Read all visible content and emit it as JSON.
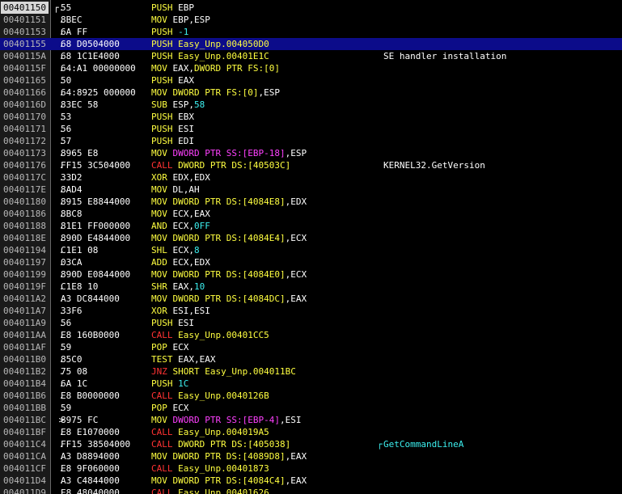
{
  "colors": {
    "background": "#000000",
    "address_column": "#1a1a1a",
    "selection": "#0c0c8a",
    "mnemonic": "#ffff40",
    "call_jump": "#ff3232",
    "pointer": "#ff40ff",
    "immediate": "#3cf0f0",
    "text": "#ffffff"
  },
  "rows": [
    {
      "addr": "00401150",
      "mark": "┌.",
      "hex": "55",
      "parts": [
        [
          "mnem",
          "PUSH "
        ],
        [
          "reg",
          "EBP"
        ]
      ],
      "comment": ""
    },
    {
      "addr": "00401151",
      "mark": " .",
      "hex": "8BEC",
      "parts": [
        [
          "mnem",
          "MOV "
        ],
        [
          "reg",
          "EBP,ESP"
        ]
      ],
      "comment": ""
    },
    {
      "addr": "00401153",
      "mark": " .",
      "hex": "6A FF",
      "parts": [
        [
          "mnem",
          "PUSH "
        ],
        [
          "imm",
          "-1"
        ]
      ],
      "comment": ""
    },
    {
      "addr": "00401155",
      "mark": " .",
      "hex": "68 D0504000",
      "parts": [
        [
          "mnem",
          "PUSH "
        ],
        [
          "sym",
          "Easy_Unp.004050D0"
        ]
      ],
      "comment": "",
      "selected": true
    },
    {
      "addr": "0040115A",
      "mark": " .",
      "hex": "68 1C1E4000",
      "parts": [
        [
          "mnem",
          "PUSH "
        ],
        [
          "sym",
          "Easy_Unp.00401E1C"
        ]
      ],
      "comment": "SE handler installation"
    },
    {
      "addr": "0040115F",
      "mark": " .",
      "hex": "64:A1 00000000",
      "parts": [
        [
          "mnem",
          "MOV "
        ],
        [
          "reg",
          "EAX,"
        ],
        [
          "mem",
          "DWORD PTR FS:[0]"
        ]
      ],
      "comment": ""
    },
    {
      "addr": "00401165",
      "mark": " .",
      "hex": "50",
      "parts": [
        [
          "mnem",
          "PUSH "
        ],
        [
          "reg",
          "EAX"
        ]
      ],
      "comment": ""
    },
    {
      "addr": "00401166",
      "mark": " .",
      "hex": "64:8925 000000",
      "parts": [
        [
          "mnem",
          "MOV "
        ],
        [
          "mem",
          "DWORD PTR FS:[0]"
        ],
        [
          "reg",
          ",ESP"
        ]
      ],
      "comment": ""
    },
    {
      "addr": "0040116D",
      "mark": " .",
      "hex": "83EC 58",
      "parts": [
        [
          "mnem",
          "SUB "
        ],
        [
          "reg",
          "ESP,"
        ],
        [
          "imm",
          "58"
        ]
      ],
      "comment": ""
    },
    {
      "addr": "00401170",
      "mark": " .",
      "hex": "53",
      "parts": [
        [
          "mnem",
          "PUSH "
        ],
        [
          "reg",
          "EBX"
        ]
      ],
      "comment": ""
    },
    {
      "addr": "00401171",
      "mark": " .",
      "hex": "56",
      "parts": [
        [
          "mnem",
          "PUSH "
        ],
        [
          "reg",
          "ESI"
        ]
      ],
      "comment": ""
    },
    {
      "addr": "00401172",
      "mark": " .",
      "hex": "57",
      "parts": [
        [
          "mnem",
          "PUSH "
        ],
        [
          "reg",
          "EDI"
        ]
      ],
      "comment": ""
    },
    {
      "addr": "00401173",
      "mark": " .",
      "hex": "8965 E8",
      "parts": [
        [
          "mnem",
          "MOV "
        ],
        [
          "ptr",
          "DWORD PTR SS:[EBP-18]"
        ],
        [
          "reg",
          ",ESP"
        ]
      ],
      "comment": ""
    },
    {
      "addr": "00401176",
      "mark": " .",
      "hex": "FF15 3C504000",
      "parts": [
        [
          "call",
          "CALL "
        ],
        [
          "mem",
          "DWORD PTR DS:[40503C]"
        ]
      ],
      "comment": "KERNEL32.GetVersion"
    },
    {
      "addr": "0040117C",
      "mark": " .",
      "hex": "33D2",
      "parts": [
        [
          "mnem",
          "XOR "
        ],
        [
          "reg",
          "EDX,EDX"
        ]
      ],
      "comment": ""
    },
    {
      "addr": "0040117E",
      "mark": " .",
      "hex": "8AD4",
      "parts": [
        [
          "mnem",
          "MOV "
        ],
        [
          "reg",
          "DL,AH"
        ]
      ],
      "comment": ""
    },
    {
      "addr": "00401180",
      "mark": " .",
      "hex": "8915 E8844000",
      "parts": [
        [
          "mnem",
          "MOV "
        ],
        [
          "mem",
          "DWORD PTR DS:[4084E8]"
        ],
        [
          "reg",
          ",EDX"
        ]
      ],
      "comment": ""
    },
    {
      "addr": "00401186",
      "mark": " .",
      "hex": "8BC8",
      "parts": [
        [
          "mnem",
          "MOV "
        ],
        [
          "reg",
          "ECX,EAX"
        ]
      ],
      "comment": ""
    },
    {
      "addr": "00401188",
      "mark": " .",
      "hex": "81E1 FF000000",
      "parts": [
        [
          "mnem",
          "AND "
        ],
        [
          "reg",
          "ECX,"
        ],
        [
          "imm",
          "0FF"
        ]
      ],
      "comment": ""
    },
    {
      "addr": "0040118E",
      "mark": " .",
      "hex": "890D E4844000",
      "parts": [
        [
          "mnem",
          "MOV "
        ],
        [
          "mem",
          "DWORD PTR DS:[4084E4]"
        ],
        [
          "reg",
          ",ECX"
        ]
      ],
      "comment": ""
    },
    {
      "addr": "00401194",
      "mark": " .",
      "hex": "C1E1 08",
      "parts": [
        [
          "mnem",
          "SHL "
        ],
        [
          "reg",
          "ECX,"
        ],
        [
          "imm",
          "8"
        ]
      ],
      "comment": ""
    },
    {
      "addr": "00401197",
      "mark": " .",
      "hex": "03CA",
      "parts": [
        [
          "mnem",
          "ADD "
        ],
        [
          "reg",
          "ECX,EDX"
        ]
      ],
      "comment": ""
    },
    {
      "addr": "00401199",
      "mark": " .",
      "hex": "890D E0844000",
      "parts": [
        [
          "mnem",
          "MOV "
        ],
        [
          "mem",
          "DWORD PTR DS:[4084E0]"
        ],
        [
          "reg",
          ",ECX"
        ]
      ],
      "comment": ""
    },
    {
      "addr": "0040119F",
      "mark": " .",
      "hex": "C1E8 10",
      "parts": [
        [
          "mnem",
          "SHR "
        ],
        [
          "reg",
          "EAX,"
        ],
        [
          "imm",
          "10"
        ]
      ],
      "comment": ""
    },
    {
      "addr": "004011A2",
      "mark": " .",
      "hex": "A3 DC844000",
      "parts": [
        [
          "mnem",
          "MOV "
        ],
        [
          "mem",
          "DWORD PTR DS:[4084DC]"
        ],
        [
          "reg",
          ",EAX"
        ]
      ],
      "comment": ""
    },
    {
      "addr": "004011A7",
      "mark": " .",
      "hex": "33F6",
      "parts": [
        [
          "mnem",
          "XOR "
        ],
        [
          "reg",
          "ESI,ESI"
        ]
      ],
      "comment": ""
    },
    {
      "addr": "004011A9",
      "mark": " .",
      "hex": "56",
      "parts": [
        [
          "mnem",
          "PUSH "
        ],
        [
          "reg",
          "ESI"
        ]
      ],
      "comment": ""
    },
    {
      "addr": "004011AA",
      "mark": " .",
      "hex": "E8 160B0000",
      "parts": [
        [
          "call",
          "CALL "
        ],
        [
          "sym",
          "Easy_Unp.00401CC5"
        ]
      ],
      "comment": ""
    },
    {
      "addr": "004011AF",
      "mark": " .",
      "hex": "59",
      "parts": [
        [
          "mnem",
          "POP "
        ],
        [
          "reg",
          "ECX"
        ]
      ],
      "comment": ""
    },
    {
      "addr": "004011B0",
      "mark": " .",
      "hex": "85C0",
      "parts": [
        [
          "mnem",
          "TEST "
        ],
        [
          "reg",
          "EAX,EAX"
        ]
      ],
      "comment": ""
    },
    {
      "addr": "004011B2",
      "mark": " .",
      "hex": "75 08",
      "parts": [
        [
          "jmp",
          "JNZ "
        ],
        [
          "sym",
          "SHORT Easy_Unp.004011BC"
        ]
      ],
      "comment": ""
    },
    {
      "addr": "004011B4",
      "mark": " .",
      "hex": "6A 1C",
      "parts": [
        [
          "mnem",
          "PUSH "
        ],
        [
          "imm",
          "1C"
        ]
      ],
      "comment": ""
    },
    {
      "addr": "004011B6",
      "mark": " .",
      "hex": "E8 B0000000",
      "parts": [
        [
          "call",
          "CALL "
        ],
        [
          "sym",
          "Easy_Unp.0040126B"
        ]
      ],
      "comment": ""
    },
    {
      "addr": "004011BB",
      "mark": " .",
      "hex": "59",
      "parts": [
        [
          "mnem",
          "POP "
        ],
        [
          "reg",
          "ECX"
        ]
      ],
      "comment": ""
    },
    {
      "addr": "004011BC",
      "mark": " >",
      "hex": "8975 FC",
      "parts": [
        [
          "mnem",
          "MOV "
        ],
        [
          "ptr",
          "DWORD PTR SS:[EBP-4]"
        ],
        [
          "reg",
          ",ESI"
        ]
      ],
      "comment": ""
    },
    {
      "addr": "004011BF",
      "mark": " .",
      "hex": "E8 E1070000",
      "parts": [
        [
          "call",
          "CALL "
        ],
        [
          "sym",
          "Easy_Unp.004019A5"
        ]
      ],
      "comment": ""
    },
    {
      "addr": "004011C4",
      "mark": " .",
      "hex": "FF15 38504000",
      "parts": [
        [
          "call",
          "CALL "
        ],
        [
          "mem",
          "DWORD PTR DS:[405038]"
        ]
      ],
      "comment": "GetCommandLineA",
      "comment_bracket": true
    },
    {
      "addr": "004011CA",
      "mark": " .",
      "hex": "A3 D8894000",
      "parts": [
        [
          "mnem",
          "MOV "
        ],
        [
          "mem",
          "DWORD PTR DS:[4089D8]"
        ],
        [
          "reg",
          ",EAX"
        ]
      ],
      "comment": ""
    },
    {
      "addr": "004011CF",
      "mark": " .",
      "hex": "E8 9F060000",
      "parts": [
        [
          "call",
          "CALL "
        ],
        [
          "sym",
          "Easy_Unp.00401873"
        ]
      ],
      "comment": ""
    },
    {
      "addr": "004011D4",
      "mark": " .",
      "hex": "A3 C4844000",
      "parts": [
        [
          "mnem",
          "MOV "
        ],
        [
          "mem",
          "DWORD PTR DS:[4084C4]"
        ],
        [
          "reg",
          ",EAX"
        ]
      ],
      "comment": ""
    },
    {
      "addr": "004011D9",
      "mark": " .",
      "hex": "E8 48040000",
      "parts": [
        [
          "call",
          "CALL "
        ],
        [
          "sym",
          "Easy_Unp.00401626"
        ]
      ],
      "comment": ""
    }
  ]
}
